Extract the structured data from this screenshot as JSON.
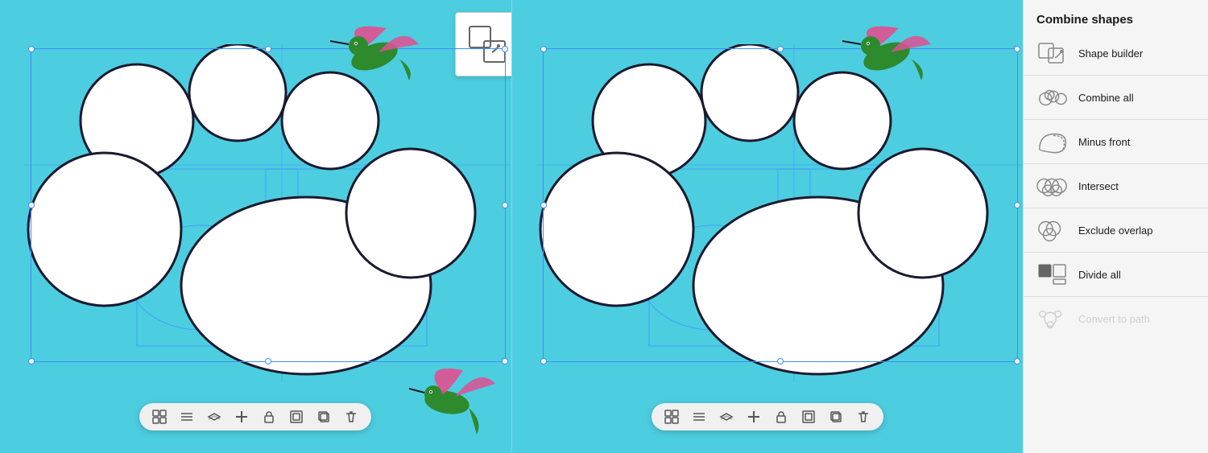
{
  "panel": {
    "title": "Combine shapes",
    "items": [
      {
        "id": "shape-builder",
        "label": "Shape builder",
        "disabled": false
      },
      {
        "id": "combine-all",
        "label": "Combine all",
        "disabled": false
      },
      {
        "id": "minus-front",
        "label": "Minus front",
        "disabled": false
      },
      {
        "id": "intersect",
        "label": "Intersect",
        "disabled": false
      },
      {
        "id": "exclude-overlap",
        "label": "Exclude overlap",
        "disabled": false
      },
      {
        "id": "divide-all",
        "label": "Divide all",
        "disabled": false
      },
      {
        "id": "convert-to-path",
        "label": "Convert to path",
        "disabled": true
      }
    ]
  },
  "toolbar": {
    "icons": [
      "grid",
      "menu",
      "layers",
      "add",
      "lock",
      "frame",
      "duplicate",
      "delete"
    ]
  },
  "colors": {
    "background": "#4dcde0",
    "selection": "#3a8fff",
    "panel_bg": "#f5f5f5"
  }
}
